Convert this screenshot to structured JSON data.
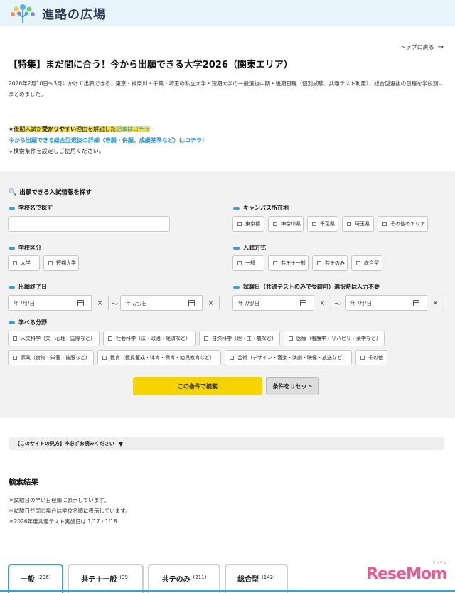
{
  "header": {
    "site_name": "進路の広場"
  },
  "nav": {
    "back_label": "トップに戻る"
  },
  "page": {
    "title": "【特集】まだ間に合う！今から出願できる大学2026（関東エリア）",
    "intro": "2026年2月10日〜3月にかけて出願できる、東京・神奈川・千葉・埼玉の私立大学・短期大学の一般選抜中期・後期日程（個別試験、共通テスト利用）、総合型選抜の日程を学校別にまとめました。"
  },
  "notes": {
    "line1_prefix": "★",
    "line1_hl1": "後期入試が",
    "line1_hl2": "受かりやすい",
    "line1_mid": "理由を解説した",
    "line1_link": "記事はコチラ",
    "line2": "今から出願できる総合型選抜の詳細（専願・併願、成績基準など）はコチラ！",
    "line3": "↓検索条件を設定しご使用ください。"
  },
  "search": {
    "heading": "出願できる入試情報を探す",
    "school_name_label": "学校名で探す",
    "school_name_value": "",
    "campus_label": "キャンパス所在地",
    "campus_options": [
      "東京都",
      "神奈川県",
      "千葉県",
      "埼玉県",
      "その他のエリア"
    ],
    "school_type_label": "学校区分",
    "school_type_options": [
      "大学",
      "短期大学"
    ],
    "exam_method_label": "入試方式",
    "exam_method_options": [
      "一般",
      "共テ＋一般",
      "共テのみ",
      "総合型"
    ],
    "deadline_label": "出願終了日",
    "exam_date_label": "試験日（共通テストのみで受験可）選択時は入力不要",
    "date_placeholder": "年 /月/日",
    "clear_label": "×",
    "tilde": "〜",
    "field_label": "学べる分野",
    "field_options_row1": [
      "人文科学（文・心理・国際など）",
      "社会科学（法・政治・経済など）",
      "自然科学（理・工・農など）",
      "医療（看護学・リハビリ・薬学など）"
    ],
    "field_options_row2": [
      "家政（食物・栄養・被服など）",
      "教育（教員養成・体育・保育・幼児教育など）",
      "芸術（デザイン・音楽・演劇・映像・放送など）",
      "その他"
    ],
    "submit_label": "この条件で検索",
    "reset_label": "条件をリセット"
  },
  "howto": {
    "label": "【このサイトの見方】※必ずお読みください",
    "toggle": "▼"
  },
  "results": {
    "title": "検索結果",
    "notes": [
      "＊試験日の早い日程順に表示しています。",
      "＊試験日が同じ場合は学校名順に表示しています。",
      "＊2026年度共通テスト実施日は 1/17・1/18"
    ]
  },
  "tabs": [
    {
      "label": "一般",
      "count": "(236)"
    },
    {
      "label": "共テ＋一般",
      "count": "(39)"
    },
    {
      "label": "共テのみ",
      "count": "(211)"
    },
    {
      "label": "総合型",
      "count": "(142)"
    }
  ],
  "watermark": {
    "text": "ReseMom",
    "sub": "リセマム"
  },
  "colors": {
    "accent": "#3a9fd6",
    "button": "#f6d400",
    "link": "#2a93d1",
    "highlight": "#f5e14a"
  }
}
